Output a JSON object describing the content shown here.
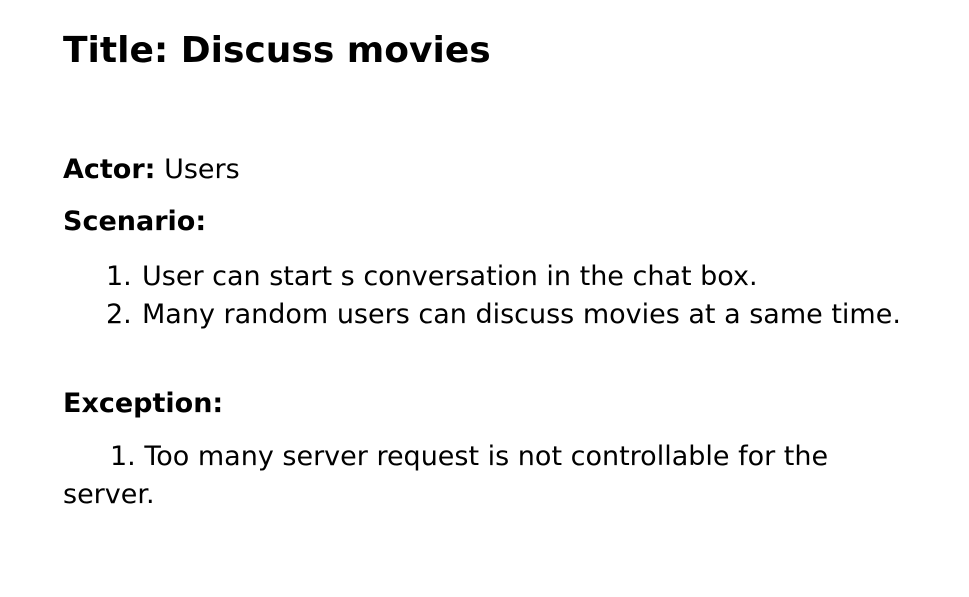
{
  "document": {
    "title": "Title: Discuss movies",
    "actor": {
      "label": "Actor:",
      "value": " Users"
    },
    "scenario": {
      "heading": "Scenario:",
      "items": [
        {
          "number": "1.",
          "text": "User can start s conversation in the chat box."
        },
        {
          "number": "2.",
          "text": "Many random users can discuss movies at a same time."
        }
      ]
    },
    "exception": {
      "heading": "Exception:",
      "text": "1. Too many server request is not controllable for the server."
    }
  }
}
